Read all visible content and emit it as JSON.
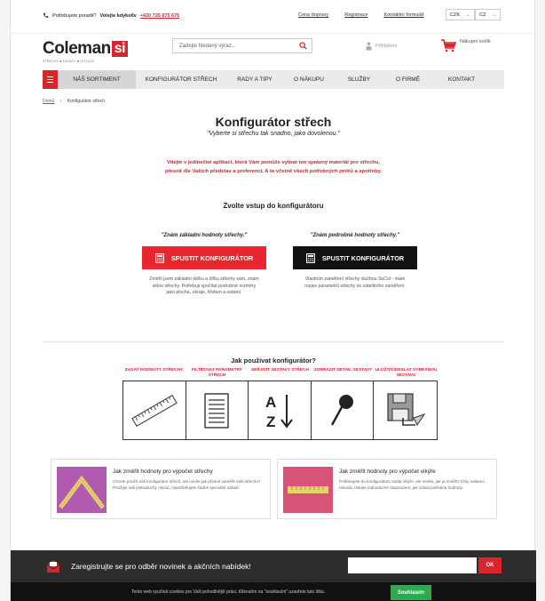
{
  "topbar": {
    "phone_text": "Potřebujete poradit?",
    "phone_bold": "Volejte kdykoliv",
    "phone_number": "+420 725 675 675",
    "links": [
      "Cena dopravy",
      "Registrace",
      "Kontaktní formulář"
    ],
    "currency": "CZK",
    "language": "CZ"
  },
  "header": {
    "logo_main": "Coleman",
    "logo_si": "si",
    "logo_sub": "STŘECHY ■ FASÁDY ■ IZOLACE",
    "search_placeholder": "Zadejte hledaný výraz...",
    "login": "Přihlášení",
    "cart": "Nákupní košík"
  },
  "nav": {
    "items": [
      "NÁŠ SORTIMENT",
      "KONFIGURÁTOR STŘECH",
      "RADY A TIPY",
      "O NÁKUPU",
      "SLUŽBY",
      "O FIRMĚ",
      "KONTAKT"
    ]
  },
  "breadcrumb": {
    "home": "Domů",
    "current": "Konfigurátor střech"
  },
  "page": {
    "title": "Konfigurátor střech",
    "subtitle": "\"Vyberte si střechu tak snadno, jako dovolenou.\"",
    "intro_line1": "Vítejte v jedinečné aplikaci, která Vám pomůže vybrat ten správný materiál pro střechu,",
    "intro_line2": "přesně dle Vašich představ a preferencí. A to včetně všech potřebných prvků a spotřeby.",
    "choose_title": "Zvolte vstup do konfigurátoru"
  },
  "options": [
    {
      "question": "\"Znám základní hodnoty střechy.\"",
      "button": "SPUSTIT KONFIGURÁTOR",
      "color": "#e8262d",
      "description": "Změřil jsem základní délku a šířku střechy sám, znám sklon střechy. Potřebuji spočítat podrobné rozměry jako plocha, okraje, hřeben a ostatní."
    },
    {
      "question": "\"Znám podrobné hodnoty střechy.\"",
      "button": "SPUSTIT KONFIGURÁTOR",
      "color": "#111111",
      "description": "Vlastním zaměření střechy službou SoCol - mám rozpis parametrů střechy ze satelitního zaměření."
    }
  ],
  "howto": {
    "title": "Jak používat konfigurátor?",
    "steps": [
      {
        "label": "ZADAT HODNOTY STŘECHY",
        "icon": "ruler-icon"
      },
      {
        "label": "FILTROVAT PARAMETRY STŘECH",
        "icon": "document-list-icon"
      },
      {
        "label": "SEŘADIT SESTAVY STŘECH",
        "icon": "sort-az-icon"
      },
      {
        "label": "ZOBRAZIT DETAIL SESTAVY",
        "icon": "magnifier-icon"
      },
      {
        "label": "ULOŽIT/ODESLAT VYBRANOU SESTAVU",
        "icon": "save-send-icon"
      }
    ]
  },
  "cards": [
    {
      "title": "Jak změřit hodnoty pro výpočet střechy",
      "text": "Chcete použít náš konfigurátor střech, ale nevíte jak přesně zaměřit Vaši střechu? Použijte náš jednoduchý návod, nepotřebujete žádné speciální nářadí."
    },
    {
      "title": "Jak změřit hodnoty pro výpočet vikýře",
      "text": "Potřebujete do konfigurátoru zadat vikýře, ale nevíte, jak je změřit? Díky našemu návodu získáte jednoduché doporučení, jak získat potřebné hodnoty."
    }
  ],
  "newsletter": {
    "title": "Zaregistrujte se pro odběr novinek a akčních nabídek!",
    "button": "OK"
  },
  "cookie": {
    "text": "Tento web využívá cookies pro Vaši pohodlnější práci. Kliknutím na \"souhlasím\" uzavřete tuto lištu.",
    "button": "Souhlasím"
  },
  "colors": {
    "brand_red": "#d9232d",
    "accept_green": "#2fa84f"
  }
}
